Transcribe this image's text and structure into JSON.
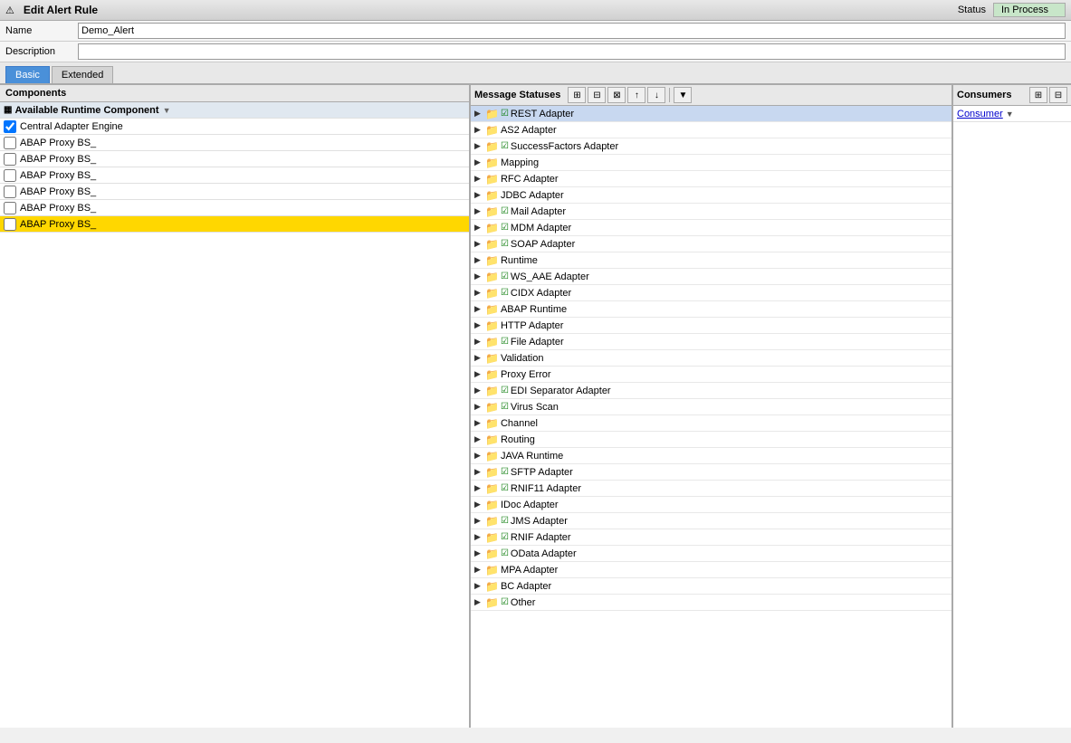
{
  "titleBar": {
    "icon": "⚠",
    "title": "Edit Alert Rule",
    "statusLabel": "Status",
    "statusValue": "In Process"
  },
  "form": {
    "nameLabel": "Name",
    "nameValue": "Demo_Alert",
    "descriptionLabel": "Description",
    "descriptionValue": ""
  },
  "tabs": [
    {
      "id": "basic",
      "label": "Basic",
      "active": true
    },
    {
      "id": "extended",
      "label": "Extended",
      "active": false
    }
  ],
  "components": {
    "header": "Components",
    "items": [
      {
        "id": "available",
        "label": "Available Runtime Component",
        "type": "header",
        "hasFilter": true,
        "checked": false
      },
      {
        "id": "central",
        "label": "Central Adapter Engine",
        "type": "item",
        "checked": true,
        "selected": false
      },
      {
        "id": "abap1",
        "label": "ABAP Proxy BS_",
        "type": "item",
        "checked": false,
        "selected": false
      },
      {
        "id": "abap2",
        "label": "ABAP Proxy BS_",
        "type": "item",
        "checked": false,
        "selected": false
      },
      {
        "id": "abap3",
        "label": "ABAP Proxy BS_",
        "type": "item",
        "checked": false,
        "selected": false
      },
      {
        "id": "abap4",
        "label": "ABAP Proxy BS_",
        "type": "item",
        "checked": false,
        "selected": false
      },
      {
        "id": "abap5",
        "label": "ABAP Proxy BS_",
        "type": "item",
        "checked": false,
        "selected": false
      },
      {
        "id": "abap6",
        "label": "ABAP Proxy BS_",
        "type": "item",
        "checked": false,
        "selected": true
      }
    ]
  },
  "messageStatuses": {
    "header": "Message Statuses",
    "toolbar": {
      "expandAll": "⊞",
      "collapseAll": "⊟",
      "btn3": "⊠",
      "btn4": "↑",
      "btn5": "↓",
      "filter": "▼"
    },
    "items": [
      {
        "id": "rest",
        "label": "REST Adapter",
        "hasCheck": true,
        "highlighted": true,
        "indent": 0
      },
      {
        "id": "as2",
        "label": "AS2 Adapter",
        "hasCheck": false,
        "indent": 0
      },
      {
        "id": "success",
        "label": "SuccessFactors Adapter",
        "hasCheck": true,
        "indent": 0
      },
      {
        "id": "mapping",
        "label": "Mapping",
        "hasCheck": false,
        "indent": 0
      },
      {
        "id": "rfc",
        "label": "RFC Adapter",
        "hasCheck": false,
        "indent": 0
      },
      {
        "id": "jdbc",
        "label": "JDBC Adapter",
        "hasCheck": false,
        "indent": 0
      },
      {
        "id": "mail",
        "label": "Mail Adapter",
        "hasCheck": true,
        "indent": 0
      },
      {
        "id": "mdm",
        "label": "MDM Adapter",
        "hasCheck": true,
        "indent": 0
      },
      {
        "id": "soap",
        "label": "SOAP Adapter",
        "hasCheck": true,
        "indent": 0
      },
      {
        "id": "runtime",
        "label": "Runtime",
        "hasCheck": false,
        "indent": 0
      },
      {
        "id": "wsaae",
        "label": "WS_AAE Adapter",
        "hasCheck": true,
        "indent": 0
      },
      {
        "id": "cidx",
        "label": "CIDX Adapter",
        "hasCheck": true,
        "indent": 0
      },
      {
        "id": "abapruntime",
        "label": "ABAP Runtime",
        "hasCheck": false,
        "indent": 0
      },
      {
        "id": "http",
        "label": "HTTP Adapter",
        "hasCheck": false,
        "indent": 0
      },
      {
        "id": "file",
        "label": "File Adapter",
        "hasCheck": true,
        "indent": 0
      },
      {
        "id": "validation",
        "label": "Validation",
        "hasCheck": false,
        "indent": 0
      },
      {
        "id": "proxyerror",
        "label": "Proxy Error",
        "hasCheck": false,
        "indent": 0
      },
      {
        "id": "edi",
        "label": "EDI Separator Adapter",
        "hasCheck": true,
        "indent": 0
      },
      {
        "id": "virusscan",
        "label": "Virus Scan",
        "hasCheck": true,
        "indent": 0
      },
      {
        "id": "channel",
        "label": "Channel",
        "hasCheck": false,
        "indent": 0
      },
      {
        "id": "routing",
        "label": "Routing",
        "hasCheck": false,
        "indent": 0
      },
      {
        "id": "java",
        "label": "JAVA Runtime",
        "hasCheck": false,
        "indent": 0
      },
      {
        "id": "sftp",
        "label": "SFTP Adapter",
        "hasCheck": true,
        "indent": 0
      },
      {
        "id": "rnif11",
        "label": "RNIF11 Adapter",
        "hasCheck": true,
        "indent": 0
      },
      {
        "id": "idoc",
        "label": "IDoc Adapter",
        "hasCheck": false,
        "indent": 0
      },
      {
        "id": "jms",
        "label": "JMS Adapter",
        "hasCheck": true,
        "indent": 0
      },
      {
        "id": "rnif",
        "label": "RNIF Adapter",
        "hasCheck": true,
        "indent": 0
      },
      {
        "id": "odata",
        "label": "OData Adapter",
        "hasCheck": true,
        "indent": 0
      },
      {
        "id": "mpa",
        "label": "MPA Adapter",
        "hasCheck": false,
        "indent": 0
      },
      {
        "id": "bc",
        "label": "BC Adapter",
        "hasCheck": false,
        "indent": 0
      },
      {
        "id": "other",
        "label": "Other",
        "hasCheck": true,
        "indent": 0
      }
    ]
  },
  "consumers": {
    "header": "Consumers",
    "items": [
      {
        "id": "consumer1",
        "label": "Consumer",
        "hasArrow": true
      }
    ]
  }
}
